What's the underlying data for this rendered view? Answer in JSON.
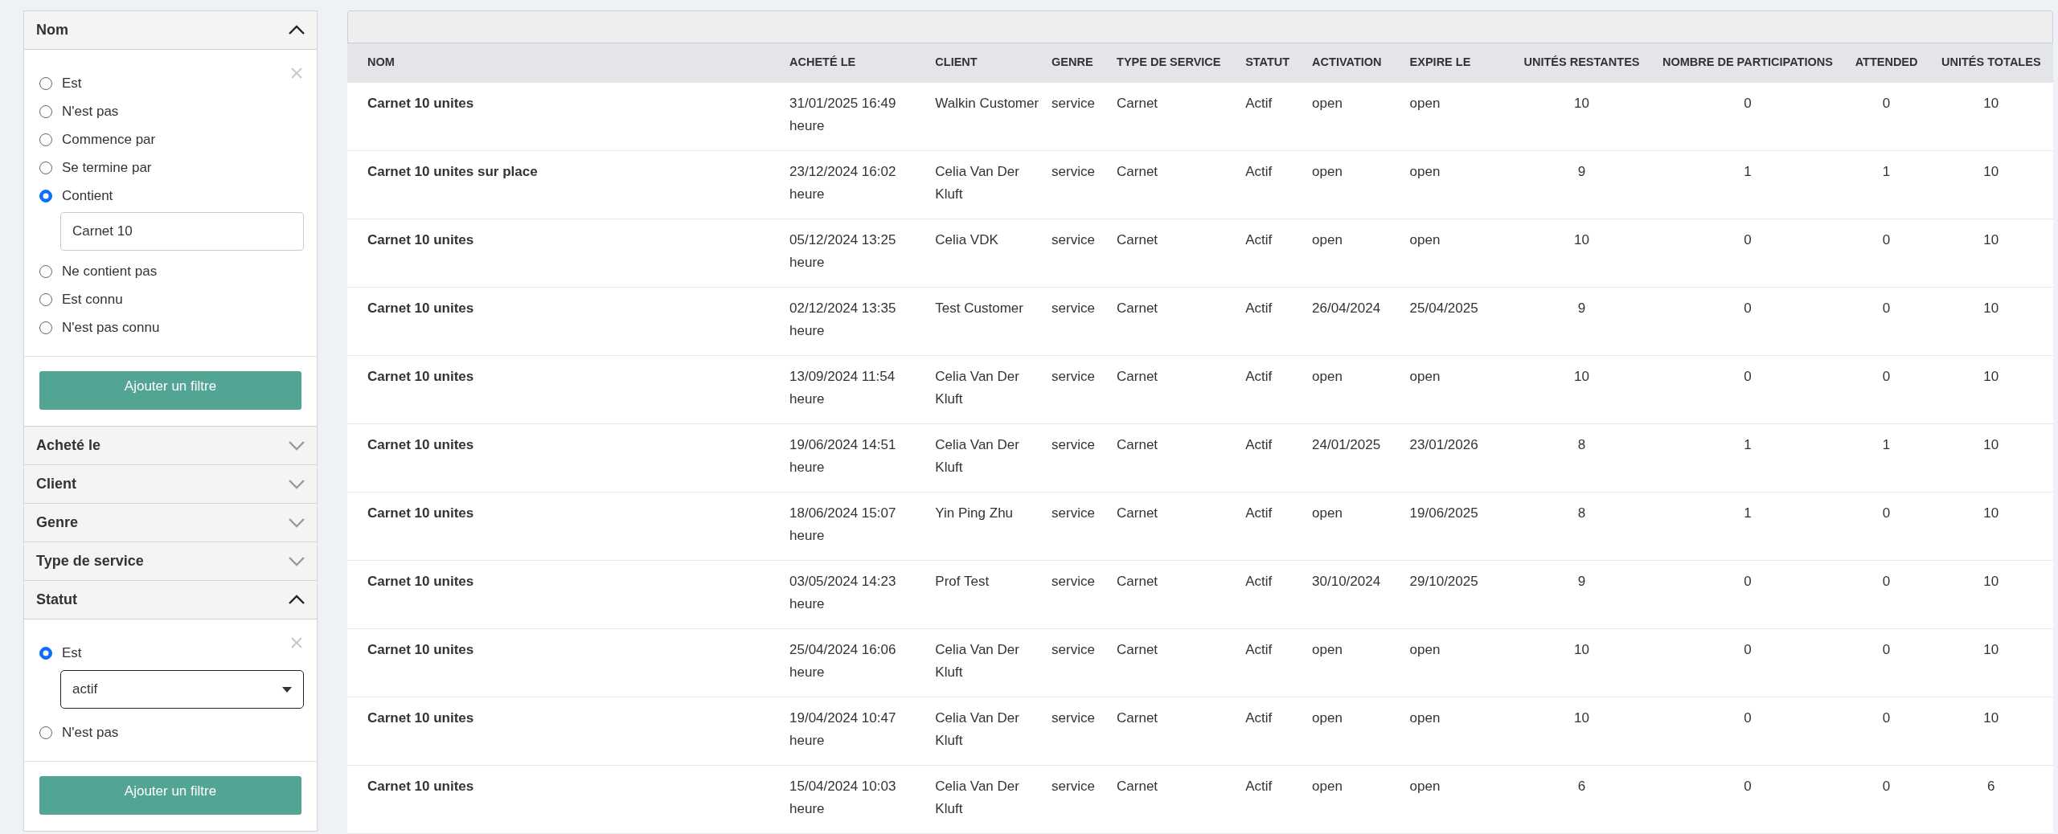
{
  "filters": [
    {
      "label": "Nom",
      "expanded": true,
      "options": [
        {
          "label": "Est",
          "selected": false
        },
        {
          "label": "N'est pas",
          "selected": false
        },
        {
          "label": "Commence par",
          "selected": false
        },
        {
          "label": "Se termine par",
          "selected": false
        },
        {
          "label": "Contient",
          "selected": true
        },
        {
          "label": "Ne contient pas",
          "selected": false
        },
        {
          "label": "Est connu",
          "selected": false
        },
        {
          "label": "N'est pas connu",
          "selected": false
        }
      ],
      "field": {
        "kind": "text",
        "value": "Carnet 10"
      },
      "button": "Ajouter un filtre"
    },
    {
      "label": "Acheté le",
      "expanded": false
    },
    {
      "label": "Client",
      "expanded": false
    },
    {
      "label": "Genre",
      "expanded": false
    },
    {
      "label": "Type de service",
      "expanded": false
    },
    {
      "label": "Statut",
      "expanded": true,
      "options": [
        {
          "label": "Est",
          "selected": true
        },
        {
          "label": "N'est pas",
          "selected": false
        }
      ],
      "field": {
        "kind": "select",
        "value": "actif"
      },
      "button": "Ajouter un filtre"
    }
  ],
  "table": {
    "columns": [
      "NOM",
      "ACHETÉ LE",
      "CLIENT",
      "GENRE",
      "TYPE DE SERVICE",
      "STATUT",
      "ACTIVATION",
      "EXPIRE LE",
      "UNITÉS RESTANTES",
      "NOMBRE DE PARTICIPATIONS",
      "ATTENDED",
      "UNITÉS TOTALES"
    ],
    "rows": [
      [
        "Carnet 10 unites",
        "31/01/2025 16:49 heure",
        "Walkin Customer",
        "service",
        "Carnet",
        "Actif",
        "open",
        "open",
        "10",
        "0",
        "0",
        "10"
      ],
      [
        "Carnet 10 unites sur place",
        "23/12/2024 16:02 heure",
        "Celia Van Der Kluft",
        "service",
        "Carnet",
        "Actif",
        "open",
        "open",
        "9",
        "1",
        "1",
        "10"
      ],
      [
        "Carnet 10 unites",
        "05/12/2024 13:25 heure",
        "Celia VDK",
        "service",
        "Carnet",
        "Actif",
        "open",
        "open",
        "10",
        "0",
        "0",
        "10"
      ],
      [
        "Carnet 10 unites",
        "02/12/2024 13:35 heure",
        "Test Customer",
        "service",
        "Carnet",
        "Actif",
        "26/04/2024",
        "25/04/2025",
        "9",
        "0",
        "0",
        "10"
      ],
      [
        "Carnet 10 unites",
        "13/09/2024 11:54 heure",
        "Celia Van Der Kluft",
        "service",
        "Carnet",
        "Actif",
        "open",
        "open",
        "10",
        "0",
        "0",
        "10"
      ],
      [
        "Carnet 10 unites",
        "19/06/2024 14:51 heure",
        "Celia Van Der Kluft",
        "service",
        "Carnet",
        "Actif",
        "24/01/2025",
        "23/01/2026",
        "8",
        "1",
        "1",
        "10"
      ],
      [
        "Carnet 10 unites",
        "18/06/2024 15:07 heure",
        "Yin Ping Zhu",
        "service",
        "Carnet",
        "Actif",
        "open",
        "19/06/2025",
        "8",
        "1",
        "0",
        "10"
      ],
      [
        "Carnet 10 unites",
        "03/05/2024 14:23 heure",
        "Prof Test",
        "service",
        "Carnet",
        "Actif",
        "30/10/2024",
        "29/10/2025",
        "9",
        "0",
        "0",
        "10"
      ],
      [
        "Carnet 10 unites",
        "25/04/2024 16:06 heure",
        "Celia Van Der Kluft",
        "service",
        "Carnet",
        "Actif",
        "open",
        "open",
        "10",
        "0",
        "0",
        "10"
      ],
      [
        "Carnet 10 unites",
        "19/04/2024 10:47 heure",
        "Celia Van Der Kluft",
        "service",
        "Carnet",
        "Actif",
        "open",
        "open",
        "10",
        "0",
        "0",
        "10"
      ],
      [
        "Carnet 10 unites",
        "15/04/2024 10:03 heure",
        "Celia Van Der Kluft",
        "service",
        "Carnet",
        "Actif",
        "open",
        "open",
        "6",
        "0",
        "0",
        "6"
      ]
    ]
  }
}
